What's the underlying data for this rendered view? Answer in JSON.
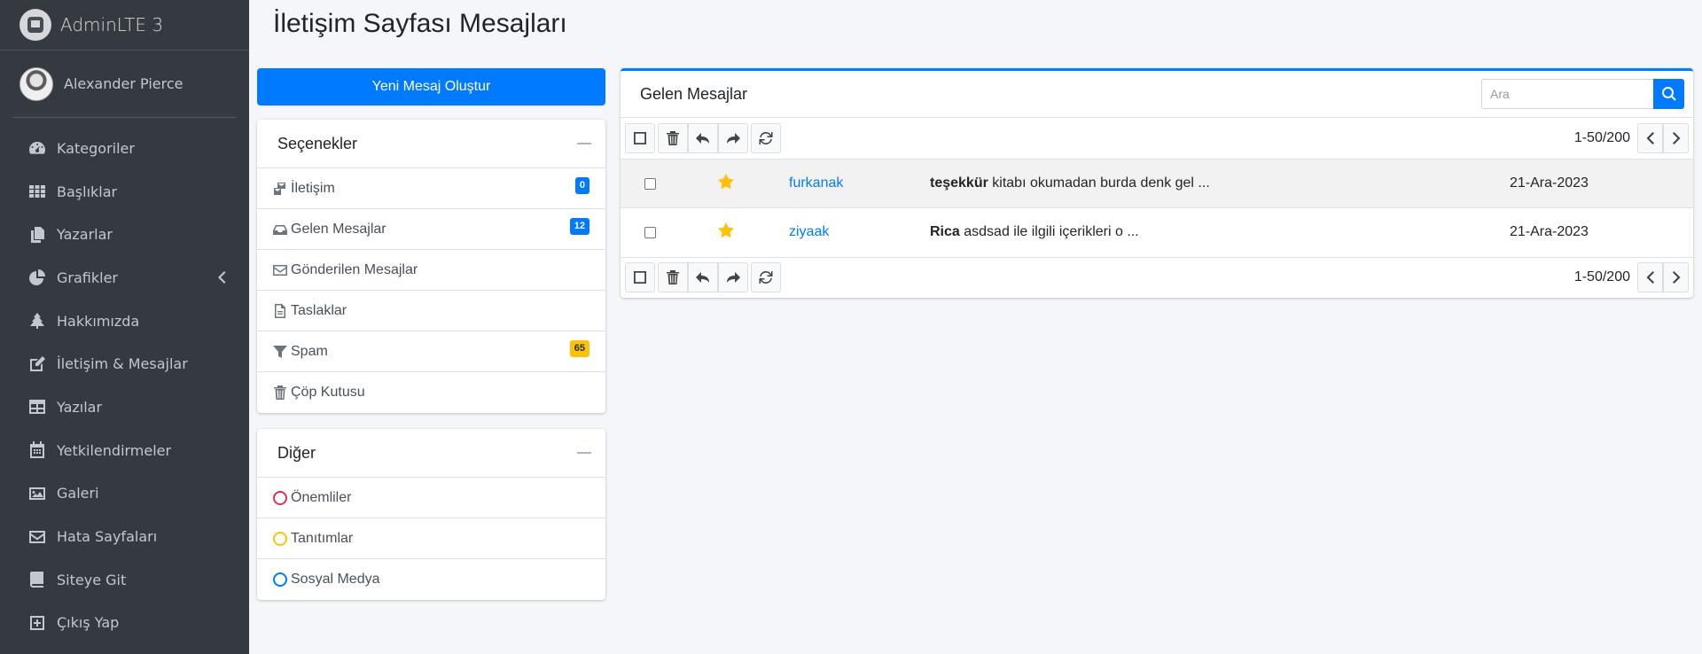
{
  "brand": {
    "name": "AdminLTE 3"
  },
  "user": {
    "name": "Alexander Pierce"
  },
  "sidebar": {
    "items": [
      {
        "label": "Kategoriler",
        "icon": "tachometer-icon"
      },
      {
        "label": "Başlıklar",
        "icon": "th-icon"
      },
      {
        "label": "Yazarlar",
        "icon": "copy-icon"
      },
      {
        "label": "Grafikler",
        "icon": "chart-pie-icon"
      },
      {
        "label": "Hakkımızda",
        "icon": "tree-icon"
      },
      {
        "label": "İletişim & Mesajlar",
        "icon": "edit-icon"
      },
      {
        "label": "Yazılar",
        "icon": "table-icon"
      },
      {
        "label": "Yetkilendirmeler",
        "icon": "calendar-icon"
      },
      {
        "label": "Galeri",
        "icon": "image-icon"
      },
      {
        "label": "Hata Sayfaları",
        "icon": "envelope-icon"
      },
      {
        "label": "Siteye Git",
        "icon": "book-icon"
      },
      {
        "label": "Çıkış Yap",
        "icon": "plus-square-icon"
      }
    ]
  },
  "page": {
    "title": "İletişim Sayfası Mesajları"
  },
  "compose": {
    "label": "Yeni Mesaj Oluştur"
  },
  "options": {
    "title": "Seçenekler",
    "items": [
      {
        "label": "İletişim",
        "badge": "0",
        "badge_color": "#007bff"
      },
      {
        "label": "Gelen Mesajlar",
        "badge": "12",
        "badge_color": "#007bff"
      },
      {
        "label": "Gönderilen Mesajlar"
      },
      {
        "label": "Taslaklar"
      },
      {
        "label": "Spam",
        "badge": "65",
        "badge_color": "#ffc107"
      },
      {
        "label": "Çöp Kutusu"
      }
    ]
  },
  "other": {
    "title": "Diğer",
    "items": [
      {
        "label": "Önemliler",
        "color": "#dc3545"
      },
      {
        "label": "Tanıtımlar",
        "color": "#ffc107"
      },
      {
        "label": "Sosyal Medya",
        "color": "#007bff"
      }
    ]
  },
  "inbox": {
    "title": "Gelen Mesajlar",
    "search_placeholder": "Ara",
    "pager_text": "1-50/200",
    "messages": [
      {
        "sender": "furkanak",
        "subject_bold": "teşekkür",
        "subject_rest": " kitabı okumadan burda denk gel ...",
        "date": "21-Ara-2023",
        "starred": true
      },
      {
        "sender": "ziyaak",
        "subject_bold": "Rica",
        "subject_rest": " asdsad ile ilgili içerikleri o ...",
        "date": "21-Ara-2023",
        "starred": true
      }
    ]
  },
  "colors": {
    "primary": "#007bff",
    "sidebar_bg": "#343a40",
    "warning": "#ffc107"
  }
}
